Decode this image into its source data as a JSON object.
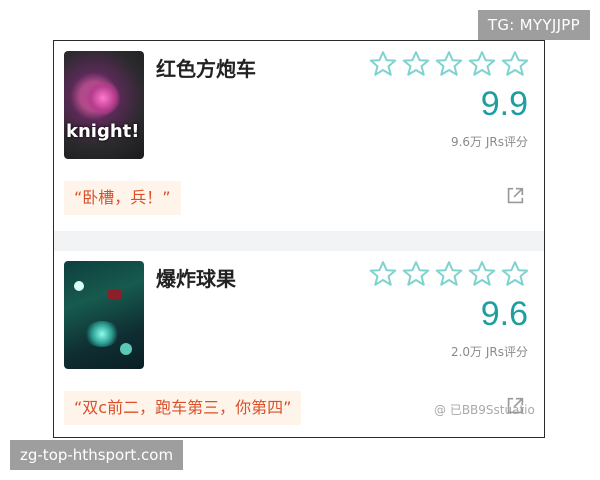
{
  "tg_badge": "TG: MYYJJPP",
  "url_badge": "zg-top-hthsport.com",
  "colors": {
    "accent": "#1f9ea0",
    "quote_text": "#d9502b",
    "quote_bg": "#fff4ea",
    "star_outline": "#7fd3cf"
  },
  "cards": [
    {
      "title": "红色方炮车",
      "thumb_overlay": "knight!",
      "rating_stars": 0,
      "score": "9.9",
      "rating_count": "9.6万 JRs评分",
      "quote": "“卧槽，兵！”",
      "icons": {
        "stars": "star-outline-icon",
        "share": "share-icon"
      }
    },
    {
      "title": "爆炸球果",
      "thumb_overlay": "",
      "rating_stars": 0,
      "score": "9.6",
      "rating_count": "2.0万 JRs评分",
      "quote": "“双c前二，跑车第三，你第四”",
      "watermark": "@ 已BB9Sstuatio",
      "icons": {
        "stars": "star-outline-icon",
        "share": "share-icon"
      }
    }
  ]
}
